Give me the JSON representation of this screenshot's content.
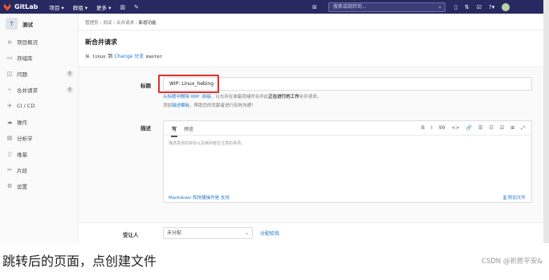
{
  "navbar": {
    "brand": "GitLab",
    "menu": [
      "项目 ▾",
      "群组 ▾",
      "更多 ▾"
    ],
    "search_placeholder": "搜索或跳转到..."
  },
  "sidebar": {
    "project_initial": "T",
    "project_name": "测试",
    "items": [
      {
        "label": "项目概况",
        "icon": "home-icon"
      },
      {
        "label": "存储库",
        "icon": "doc-icon"
      },
      {
        "label": "问题",
        "icon": "issues-icon",
        "count": "0"
      },
      {
        "label": "合并请求",
        "icon": "merge-request-icon",
        "count": "0"
      },
      {
        "label": "CI / CD",
        "icon": "rocket-icon"
      },
      {
        "label": "操作",
        "icon": "cloud-icon"
      },
      {
        "label": "分析学",
        "icon": "chart-icon"
      },
      {
        "label": "维基",
        "icon": "book-icon"
      },
      {
        "label": "片段",
        "icon": "scissors-icon"
      },
      {
        "label": "设置",
        "icon": "gear-icon"
      }
    ]
  },
  "breadcrumbs": [
    "管理员",
    "测试",
    "合并请求",
    "新增功能"
  ],
  "page": {
    "title": "新合并请求",
    "from_word": "从",
    "source_branch": "linux",
    "to_word": "到",
    "change_link": "Change 分支",
    "target_branch": "master"
  },
  "form": {
    "title_label": "标题",
    "title_value": "WIP: Linux_hebing",
    "hint_line1_link": "从标题中删除 WIP: 前缀",
    "hint_line1_rest": "，以允许在准备就绪时合并此",
    "hint_line1_bold": "正在进行的工作",
    "hint_line1_end": "合并请求。",
    "hint_line2_prefix": "添加",
    "hint_line2_link": "描述模板",
    "hint_line2_rest": "，帮助您的贡献者进行有效沟通！",
    "desc_label": "描述",
    "tab_write": "写",
    "tab_preview": "预览",
    "toolbar": [
      "B",
      "I",
      "99",
      "<>",
      "🔗",
      "☰",
      "☷",
      "☑",
      "⊞",
      "⤢"
    ],
    "desc_placeholder": "描述更改的目标以及审阅者应注意的事项。",
    "markdown_text": "Markdown 和快捷操作是 支持",
    "attach_text": "附加文件",
    "assignee_label": "受让人",
    "assignee_value": "未分配",
    "assign_me": "分配给我"
  },
  "caption": "跳转后的页面，点创建文件",
  "watermark": "CSDN @祈愿平安&"
}
